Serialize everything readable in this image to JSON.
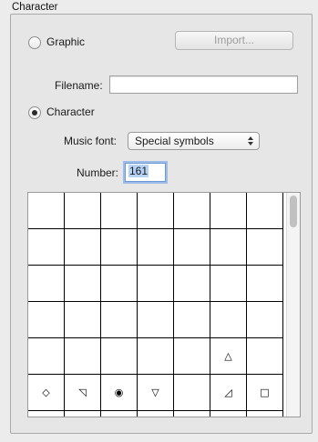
{
  "group": {
    "title": "Character"
  },
  "graphic": {
    "label": "Graphic",
    "selected": false
  },
  "import_button": {
    "label": "Import...",
    "enabled": false
  },
  "filename": {
    "label": "Filename:",
    "value": ""
  },
  "character": {
    "label": "Character",
    "selected": true
  },
  "music_font": {
    "label": "Music font:",
    "value": "Special symbols"
  },
  "number": {
    "label": "Number:",
    "value": "161"
  },
  "symbol_grid": {
    "columns": 7,
    "rows": [
      [
        "",
        "",
        "",
        "",
        "",
        "",
        ""
      ],
      [
        "",
        "",
        "",
        "",
        "",
        "",
        ""
      ],
      [
        "",
        "",
        "",
        "",
        "",
        "",
        ""
      ],
      [
        "",
        "",
        "",
        "",
        "",
        "",
        ""
      ],
      [
        "",
        "",
        "",
        "",
        "",
        "△",
        ""
      ],
      [
        "◇",
        "◹",
        "◉",
        "▽",
        "",
        "◿",
        "□"
      ],
      [
        "",
        "",
        "",
        "",
        "",
        "",
        ""
      ]
    ]
  }
}
